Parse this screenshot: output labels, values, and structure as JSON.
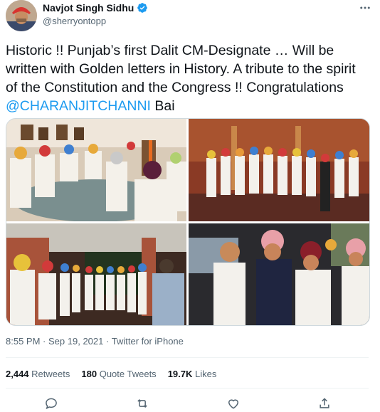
{
  "author": {
    "display_name": "Navjot Singh Sidhu",
    "handle": "@sherryontopp",
    "verified": true
  },
  "tweet": {
    "text_before": "Historic !! Punjab’s first Dalit CM-Designate … Will be written with Golden letters in History. A tribute to the spirit of the Constitution and the Congress !! Congratulations ",
    "mention": "@CHARANJITCHANNI",
    "text_after": " Bai"
  },
  "meta": {
    "time": "8:55 PM",
    "date": "Sep 19, 2021",
    "separator": "·",
    "source": "Twitter for iPhone"
  },
  "stats": {
    "retweets_count": "2,444",
    "retweets_label": "Retweets",
    "quotes_count": "180",
    "quotes_label": "Quote Tweets",
    "likes_count": "19.7K",
    "likes_label": "Likes"
  },
  "icons": {
    "more": "more-horizontal-icon",
    "reply": "reply-icon",
    "retweet": "retweet-icon",
    "like": "heart-icon",
    "share": "share-icon",
    "verified": "verified-badge-icon"
  },
  "colors": {
    "accent": "#1d9bf0",
    "text": "#0f1419",
    "muted": "#536471",
    "border": "#cfd9de"
  }
}
